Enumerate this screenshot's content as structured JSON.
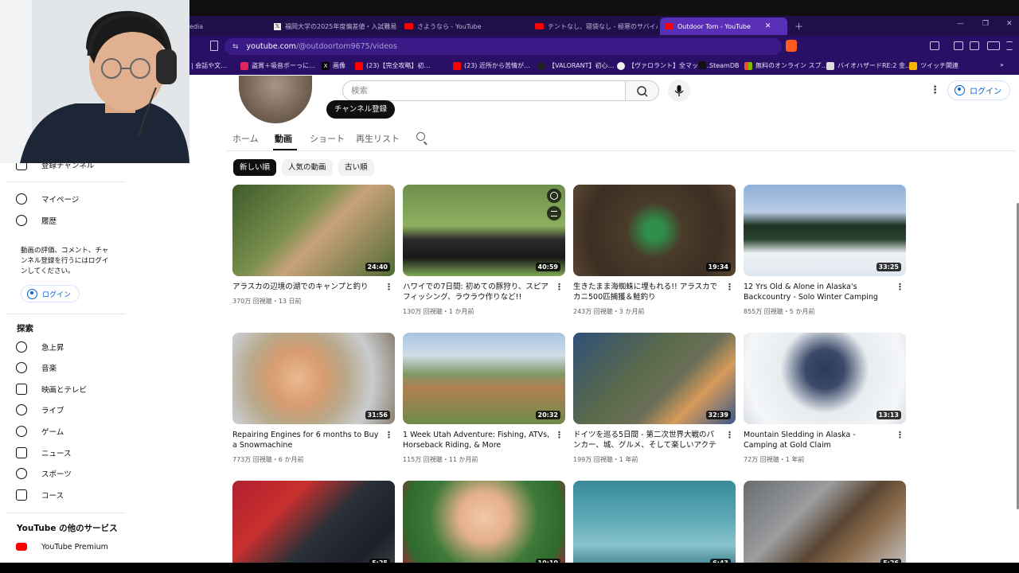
{
  "browser": {
    "tabs": [
      {
        "title": "edia",
        "favicon": "none"
      },
      {
        "title": "福岡大学の2025年度偏差値・入試難易",
        "favicon": "x"
      },
      {
        "title": "さようなら - YouTube",
        "favicon": "youtube"
      },
      {
        "title": "テントなし、寝袋なし - 極寒のサバイバ",
        "favicon": "youtube"
      },
      {
        "title": "Outdoor Tom - YouTube",
        "favicon": "youtube",
        "active": true
      }
    ],
    "url": {
      "host": "youtube.com",
      "path": "/@outdoortom9675/videos"
    },
    "bookmarks": [
      "| 会話や文…",
      "盗賞＋吸音ボーっに…",
      "画像",
      "(23)【完全攻略】初…",
      "(23) 近所から苦情が…",
      "【VALORANT】初心…",
      "【ヴァロラント】全マップ…",
      "SteamDB",
      "無料のオンライン スプ…",
      "バイオハザードRE:2 金…",
      "ツイッチ関連"
    ]
  },
  "header": {
    "search_placeholder": "検索",
    "login_label": "ログイン"
  },
  "channel": {
    "subscribe_label": "チャンネル登録",
    "tabs": [
      "ホーム",
      "動画",
      "ショート",
      "再生リスト"
    ],
    "active_tab": 1
  },
  "chips": [
    "新しい順",
    "人気の動画",
    "古い順"
  ],
  "videos": [
    {
      "title": "アラスカの辺境の湖でのキャンプと釣り",
      "duration": "24:40",
      "meta": "370万 回視聴・13 日前"
    },
    {
      "title": "ハワイでの7日間: 初めての豚狩り、スピアフィッシング、ラウラウ作りなど!!",
      "duration": "40:59",
      "meta": "130万 回視聴・1 か月前"
    },
    {
      "title": "生きたまま海蜘蛛に埋もれる!! アラスカでカニ500匹捕獲＆鮭釣り",
      "duration": "19:34",
      "meta": "243万 回視聴・3 か月前"
    },
    {
      "title": "12 Yrs Old & Alone in Alaska's Backcountry - Solo Winter Camping",
      "duration": "33:25",
      "meta": "855万 回視聴・5 か月前"
    },
    {
      "title": "Repairing Engines for 6 months to Buy a Snowmachine",
      "duration": "31:56",
      "meta": "773万 回視聴・6 か月前"
    },
    {
      "title": "1 Week Utah Adventure: Fishing, ATVs, Horseback Riding, & More",
      "duration": "20:32",
      "meta": "115万 回視聴・11 か月前"
    },
    {
      "title": "ドイツを巡る5日間 - 第二次世界大戦のパンカー、城、グルメ、そして楽しいアクティ…",
      "duration": "32:39",
      "meta": "199万 回視聴・1 年前"
    },
    {
      "title": "Mountain Sledding in Alaska - Camping at Gold Claim",
      "duration": "13:13",
      "meta": "72万 回視聴・1 年前"
    },
    {
      "title": "",
      "duration": "5:25",
      "meta": ""
    },
    {
      "title": "",
      "duration": "10:10",
      "meta": ""
    },
    {
      "title": "",
      "duration": "6:43",
      "meta": ""
    },
    {
      "title": "",
      "duration": "5:26",
      "meta": ""
    }
  ],
  "sidebar": {
    "top_partial": "登録チャンネル",
    "you_items": [
      "マイページ",
      "履歴"
    ],
    "login_note": "動画の評価、コメント、チャンネル登録を行うにはログインしてください。",
    "login_label": "ログイン",
    "explore_heading": "探索",
    "explore_items": [
      "急上昇",
      "音楽",
      "映画とテレビ",
      "ライブ",
      "ゲーム",
      "ニュース",
      "スポーツ",
      "コース"
    ],
    "more_heading": "YouTube の他のサービス",
    "more_items": [
      "YouTube Premium"
    ]
  },
  "colors": {
    "tabbar": "#1f0f4a",
    "active_tab": "#5a2fb8",
    "youtube_red": "#ff0000",
    "link_blue": "#065fd4"
  }
}
